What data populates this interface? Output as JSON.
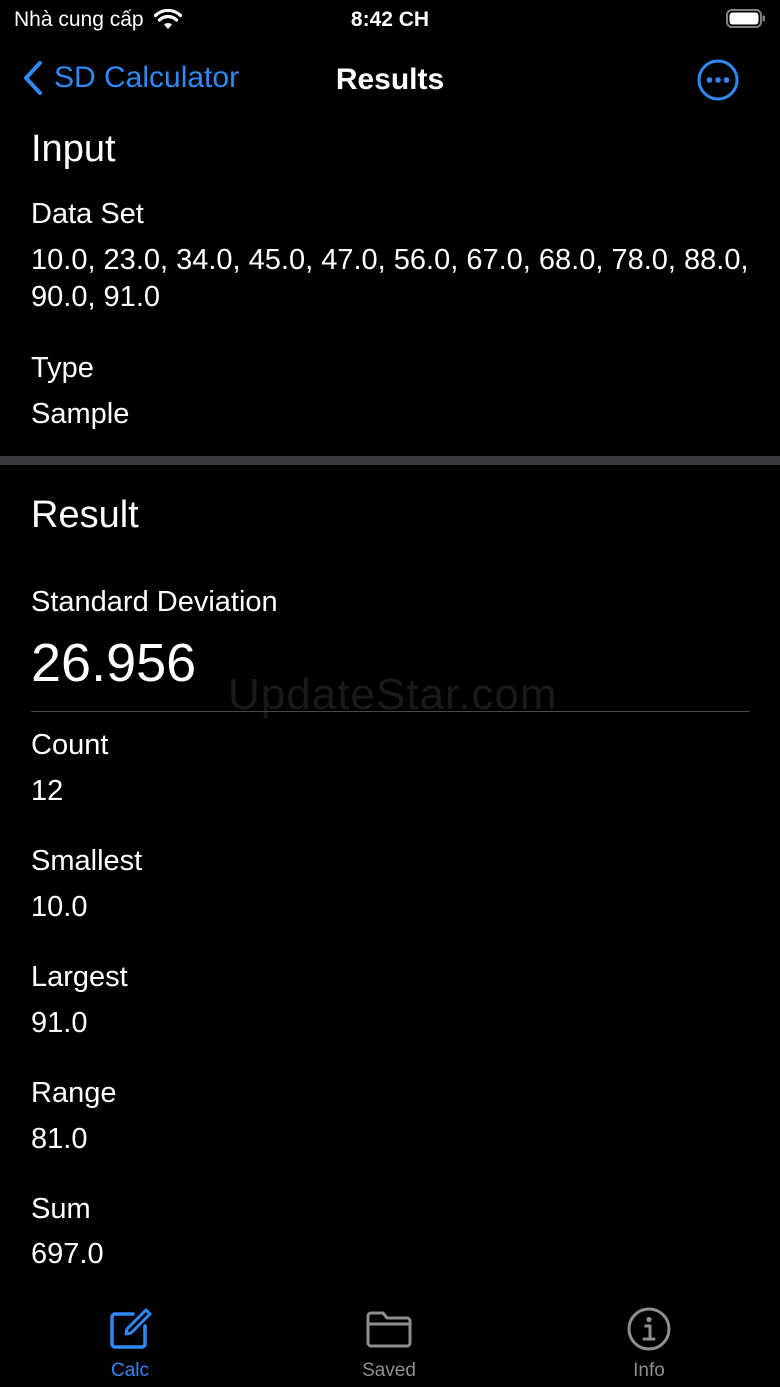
{
  "status_bar": {
    "carrier": "Nhà cung cấp",
    "time": "8:42 CH"
  },
  "nav": {
    "back_label": "SD Calculator",
    "title": "Results"
  },
  "input": {
    "section_title": "Input",
    "dataset_label": "Data Set",
    "dataset_value": "10.0, 23.0, 34.0, 45.0, 47.0, 56.0, 67.0, 68.0, 78.0, 88.0, 90.0, 91.0",
    "type_label": "Type",
    "type_value": "Sample"
  },
  "result": {
    "section_title": "Result",
    "sd_label": "Standard Deviation",
    "sd_value": "26.956",
    "count_label": "Count",
    "count_value": "12",
    "smallest_label": "Smallest",
    "smallest_value": "10.0",
    "largest_label": "Largest",
    "largest_value": "91.0",
    "range_label": "Range",
    "range_value": "81.0",
    "sum_label": "Sum",
    "sum_value": "697.0"
  },
  "watermark": "UpdateStar.com",
  "tabs": [
    {
      "label": "Calc",
      "icon": "edit-icon",
      "active": true
    },
    {
      "label": "Saved",
      "icon": "folder-icon",
      "active": false
    },
    {
      "label": "Info",
      "icon": "info-icon",
      "active": false
    }
  ],
  "colors": {
    "accent": "#2f89f5",
    "background": "#000000",
    "inactive": "#8e8e93"
  }
}
